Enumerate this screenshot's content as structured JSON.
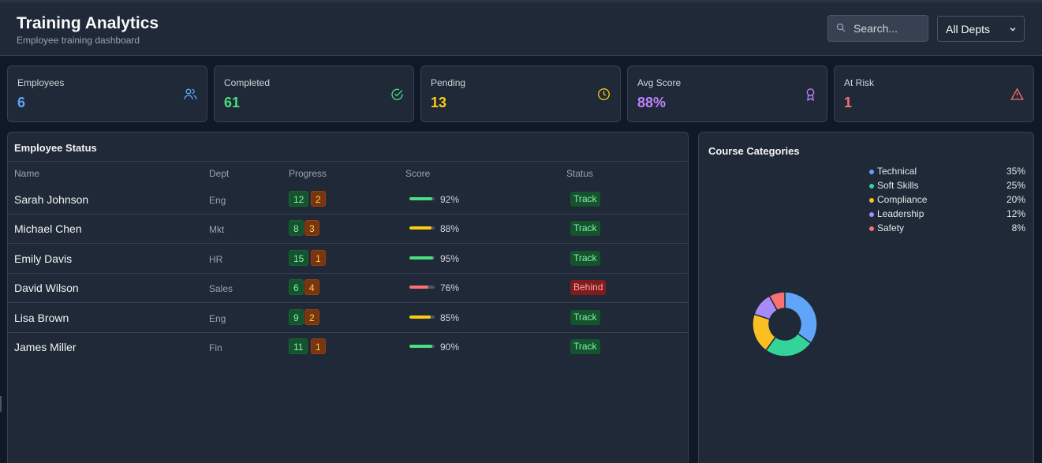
{
  "header": {
    "title": "Training Analytics",
    "subtitle": "Employee training dashboard",
    "search_placeholder": "Search...",
    "dept_filter": "All Depts"
  },
  "stats": [
    {
      "label": "Employees",
      "value": "6",
      "color": "#60a5fa",
      "icon": "users-icon"
    },
    {
      "label": "Completed",
      "value": "61",
      "color": "#4ade80",
      "icon": "check-circle-icon"
    },
    {
      "label": "Pending",
      "value": "13",
      "color": "#facc15",
      "icon": "clock-icon"
    },
    {
      "label": "Avg Score",
      "value": "88%",
      "color": "#c084fc",
      "icon": "award-icon"
    },
    {
      "label": "At Risk",
      "value": "1",
      "color": "#f87171",
      "icon": "alert-triangle-icon"
    }
  ],
  "employee_status": {
    "title": "Employee Status",
    "columns": [
      "Name",
      "Dept",
      "Progress",
      "Score",
      "Status"
    ],
    "rows": [
      {
        "name": "Sarah Johnson",
        "dept": "Eng",
        "completed": "12",
        "pending": "2",
        "score": "92%",
        "score_value": 92,
        "bar_color": "#4ade80",
        "status": "Track",
        "status_kind": "ok"
      },
      {
        "name": "Michael Chen",
        "dept": "Mkt",
        "completed": "8",
        "pending": "3",
        "score": "88%",
        "score_value": 88,
        "bar_color": "#facc15",
        "status": "Track",
        "status_kind": "ok"
      },
      {
        "name": "Emily Davis",
        "dept": "HR",
        "completed": "15",
        "pending": "1",
        "score": "95%",
        "score_value": 95,
        "bar_color": "#4ade80",
        "status": "Track",
        "status_kind": "ok"
      },
      {
        "name": "David Wilson",
        "dept": "Sales",
        "completed": "6",
        "pending": "4",
        "score": "76%",
        "score_value": 76,
        "bar_color": "#f87171",
        "status": "Behind",
        "status_kind": "bad"
      },
      {
        "name": "Lisa Brown",
        "dept": "Eng",
        "completed": "9",
        "pending": "2",
        "score": "85%",
        "score_value": 85,
        "bar_color": "#facc15",
        "status": "Track",
        "status_kind": "ok"
      },
      {
        "name": "James Miller",
        "dept": "Fin",
        "completed": "11",
        "pending": "1",
        "score": "90%",
        "score_value": 90,
        "bar_color": "#4ade80",
        "status": "Track",
        "status_kind": "ok"
      }
    ]
  },
  "course_categories": {
    "title": "Course Categories",
    "items": [
      {
        "name": "Technical",
        "pct": "35%",
        "value": 35,
        "color": "#60a5fa"
      },
      {
        "name": "Soft Skills",
        "pct": "25%",
        "value": 25,
        "color": "#34d399"
      },
      {
        "name": "Compliance",
        "pct": "20%",
        "value": 20,
        "color": "#fbbf24"
      },
      {
        "name": "Leadership",
        "pct": "12%",
        "value": 12,
        "color": "#a78bfa"
      },
      {
        "name": "Safety",
        "pct": "8%",
        "value": 8,
        "color": "#f87171"
      }
    ]
  }
}
